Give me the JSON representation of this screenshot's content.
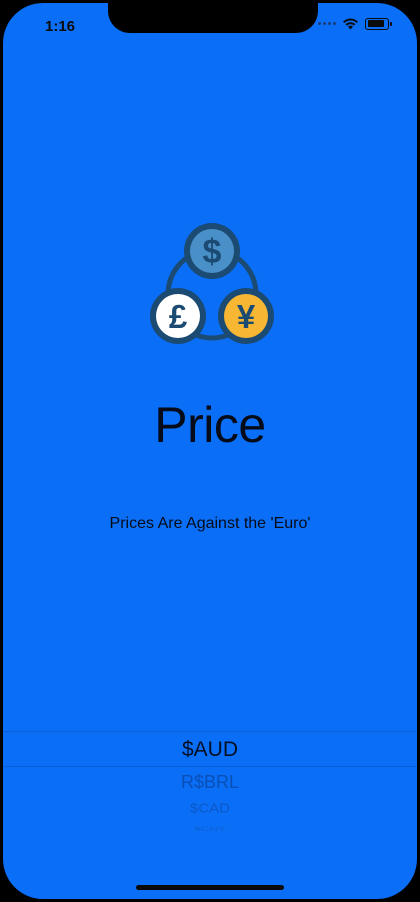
{
  "status_bar": {
    "time": "1:16",
    "battery_level": 0.9
  },
  "logo": {
    "icon": "currency-exchange-icon",
    "dollar": "$",
    "pound": "£",
    "yen": "¥"
  },
  "title": "Price",
  "subtitle": "Prices Are Against the 'Euro'",
  "picker": {
    "items": [
      "$AUD",
      "R$BRL",
      "$CAD",
      "¥CNY"
    ],
    "selected": "$AUD"
  },
  "colors": {
    "background": "#0A6EF6",
    "dark_outline": "#1B4A73",
    "dollar_fill": "#4A90C8",
    "pound_fill": "#FFFFFF",
    "yen_fill": "#F7B733"
  }
}
